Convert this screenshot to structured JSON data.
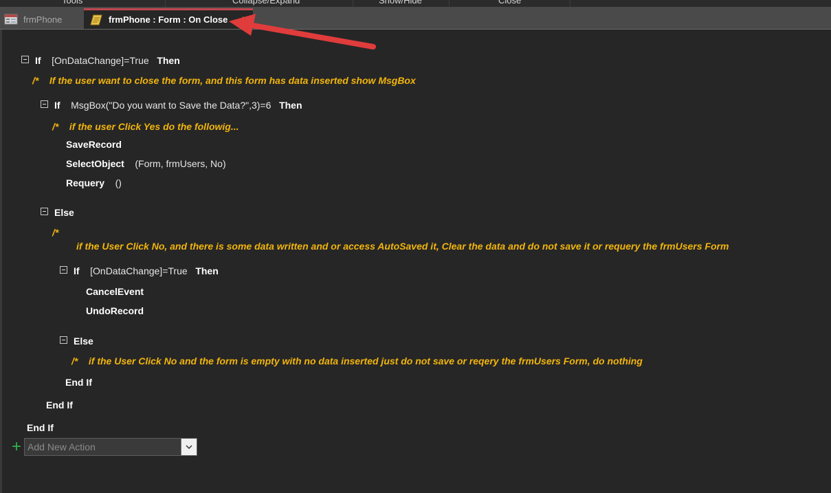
{
  "ribbon": {
    "groups": [
      "Tools",
      "Collapse/Expand",
      "Show/Hide",
      "Close"
    ]
  },
  "tabs": {
    "inactive_label": "frmPhone",
    "active_label": "frmPhone : Form : On Close",
    "close_glyph": "×"
  },
  "macro": {
    "if1": {
      "kw": "If",
      "cond": "[OnDataChange]=True",
      "then": "Then"
    },
    "cmt1": {
      "marker": "/*",
      "text": "If the user want to close the form, and this form has data inserted show MsgBox"
    },
    "if2": {
      "kw": "If",
      "cond": "MsgBox(\"Do you want to Save the Data?\",3)=6",
      "then": "Then"
    },
    "cmt2": {
      "marker": "/*",
      "text": "if the user Click Yes do the followig..."
    },
    "act_save": {
      "name": "SaveRecord"
    },
    "act_select": {
      "name": "SelectObject",
      "args": "(Form, frmUsers, No)"
    },
    "act_requery": {
      "name": "Requery",
      "args": "()"
    },
    "else1": "Else",
    "cmt3": {
      "marker": "/*",
      "text": "if the User Click No, and there is some data written and or access AutoSaved it, Clear the data and do not save it or requery the frmUsers Form"
    },
    "if3": {
      "kw": "If",
      "cond": "[OnDataChange]=True",
      "then": "Then"
    },
    "act_cancel": "CancelEvent",
    "act_undo": "UndoRecord",
    "else2": "Else",
    "cmt4": {
      "marker": "/*",
      "text": "if the User Click No and the form is empty with no data inserted  just do not save or reqery the frmUsers Form, do nothing"
    },
    "endif3": "End If",
    "endif2": "End If",
    "endif1": "End If"
  },
  "add_action": {
    "placeholder": "Add New Action"
  },
  "colors": {
    "comment": "#f2b50c",
    "arrow": "#e03c3c",
    "plus": "#2fb34a",
    "tab_accent": "#c0474e"
  },
  "icons": [
    "collapse-toggle-icon",
    "form-icon",
    "macro-icon",
    "close-icon",
    "plus-icon",
    "chevron-down-icon",
    "annotation-arrow"
  ]
}
